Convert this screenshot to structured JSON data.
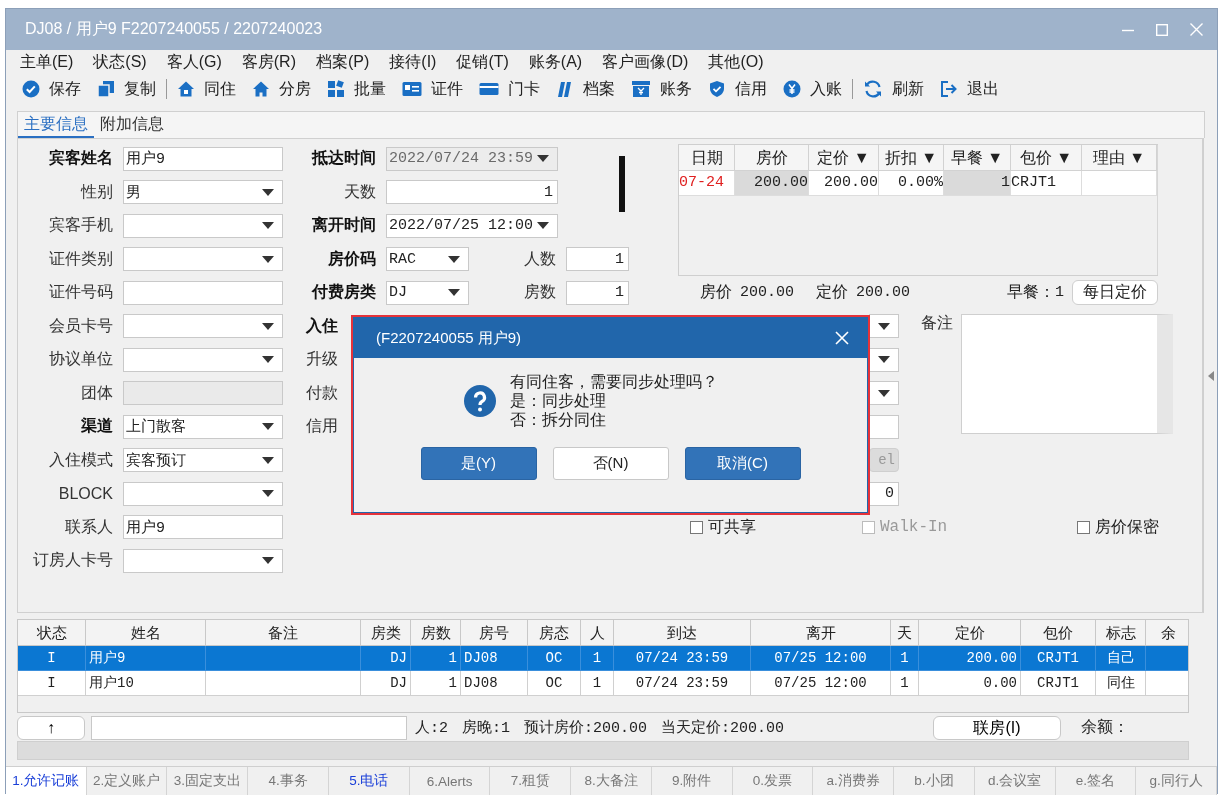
{
  "window": {
    "title": "DJ08 / 用户9 F2207240055 / 2207240023"
  },
  "menu": [
    "主单(E)",
    "状态(S)",
    "客人(G)",
    "客房(R)",
    "档案(P)",
    "接待(I)",
    "促销(T)",
    "账务(A)",
    "客户画像(D)",
    "其他(O)"
  ],
  "toolbar_groups": [
    [
      "保存",
      "复制"
    ],
    [
      "同住",
      "分房",
      "批量",
      "证件",
      "门卡",
      "档案",
      "账务",
      "信用",
      "入账"
    ],
    [
      "刷新",
      "退出"
    ]
  ],
  "tabs": [
    {
      "label": "主要信息",
      "selected": true
    },
    {
      "label": "附加信息",
      "selected": false
    }
  ],
  "guest_form": [
    {
      "label": "宾客姓名",
      "bold": true,
      "kind": "text",
      "value": "用户9"
    },
    {
      "label": "性别",
      "bold": false,
      "kind": "combo",
      "value": "男"
    },
    {
      "label": "宾客手机",
      "bold": false,
      "kind": "combo"
    },
    {
      "label": "证件类别",
      "bold": false,
      "kind": "combo"
    },
    {
      "label": "证件号码",
      "bold": false,
      "kind": "text"
    },
    {
      "label": "会员卡号",
      "bold": false,
      "kind": "combo"
    },
    {
      "label": "协议单位",
      "bold": false,
      "kind": "combo"
    },
    {
      "label": "团体",
      "bold": false,
      "kind": "readonly"
    },
    {
      "label": "渠道",
      "bold": true,
      "kind": "combo",
      "value": "上门散客"
    },
    {
      "label": "入住模式",
      "bold": false,
      "kind": "combo",
      "value": "宾客预订"
    },
    {
      "label": "BLOCK",
      "bold": false,
      "kind": "combo"
    },
    {
      "label": "联系人",
      "bold": false,
      "kind": "text",
      "value": "用户9"
    },
    {
      "label": "订房人卡号",
      "bold": false,
      "kind": "combo"
    }
  ],
  "stay_form": [
    {
      "label": "抵达时间",
      "bold": true,
      "kind": "combo",
      "value": "2022/07/24 23:59",
      "disabled": true
    },
    {
      "label": "天数",
      "bold": false,
      "kind": "number",
      "value": "1"
    },
    {
      "label": "离开时间",
      "bold": true,
      "kind": "combo",
      "value": "2022/07/25 12:00",
      "disabled": false
    },
    {
      "label": "房价码",
      "bold": true,
      "kind": "short_combo",
      "value": "RAC",
      "extra": {
        "label": "人数",
        "value": "1"
      }
    },
    {
      "label": "付费房类",
      "bold": true,
      "kind": "short_combo",
      "value": "DJ",
      "extra": {
        "label": "房数",
        "value": "1"
      }
    },
    {
      "label": "入住",
      "bold": true,
      "kind": "combo_stub"
    },
    {
      "label": "升级",
      "bold": false,
      "kind": "combo_stub"
    },
    {
      "label": "付款",
      "bold": false,
      "kind": "combo_stub"
    },
    {
      "label": "信用",
      "bold": false,
      "kind": "input_stub"
    },
    {
      "kind": "button_stub",
      "value": "el",
      "disabled": true
    },
    {
      "kind": "input_stub",
      "value": "0"
    }
  ],
  "rate_grid": {
    "columns": [
      "日期",
      "房价",
      "定价 ▼",
      "折扣 ▼",
      "早餐 ▼",
      "包价 ▼",
      "理由 ▼"
    ],
    "rows": [
      {
        "date": "07-24",
        "rate": "200.00",
        "fixed": "200.00",
        "discount": "0.00%",
        "breakfast": "1",
        "package": "CRJT1"
      }
    ]
  },
  "rate_summary": {
    "rate_label": "房价",
    "rate": "200.00",
    "fixed_label": "定价",
    "fixed": "200.00",
    "breakfast_label": "早餐：",
    "breakfast": "1",
    "button": "每日定价"
  },
  "remarks": {
    "label": "备注"
  },
  "checkboxes": [
    {
      "label": "可共享",
      "checked": false,
      "disabled": false
    },
    {
      "label": "Walk-In",
      "checked": false,
      "disabled": true
    },
    {
      "label": "房价保密",
      "checked": false,
      "disabled": false
    }
  ],
  "guest_table": {
    "columns": [
      "状态",
      "姓名",
      "备注",
      "房类",
      "房数",
      "房号",
      "房态",
      "人",
      "到达",
      "离开",
      "天",
      "定价",
      "包价",
      "标志",
      "余"
    ],
    "rows": [
      {
        "selected": true,
        "status": "I",
        "name": "用户9",
        "room_type": "DJ",
        "rooms": "1",
        "room_no": "DJ08",
        "room_state": "OC",
        "persons": "1",
        "arrival": "07/24 23:59",
        "departure": "07/25 12:00",
        "days": "1",
        "rate": "200.00",
        "package": "CRJT1",
        "flag": "自己"
      },
      {
        "selected": false,
        "status": "I",
        "name": "用户10",
        "room_type": "DJ",
        "rooms": "1",
        "room_no": "DJ08",
        "room_state": "OC",
        "persons": "1",
        "arrival": "07/24 23:59",
        "departure": "07/25 12:00",
        "days": "1",
        "rate": "0.00",
        "package": "CRJT1",
        "flag": "同住"
      }
    ]
  },
  "footer": {
    "up_button": "↑",
    "persons": "人:2",
    "nights": "房晚:1",
    "expected_rate": "预计房价:200.00",
    "today_rate": "当天定价:200.00",
    "link_button": "联房(I)",
    "balance_label": "余额："
  },
  "bottom_tabs": [
    {
      "label": "1.允许记账",
      "selected": true,
      "highlighted": true
    },
    {
      "label": "2.定义账户",
      "selected": false,
      "highlighted": false
    },
    {
      "label": "3.固定支出",
      "selected": false,
      "highlighted": false
    },
    {
      "label": "4.事务",
      "selected": false,
      "highlighted": false
    },
    {
      "label": "5.电话",
      "selected": false,
      "highlighted": true
    },
    {
      "label": "6.Alerts",
      "selected": false,
      "highlighted": false
    },
    {
      "label": "7.租赁",
      "selected": false,
      "highlighted": false
    },
    {
      "label": "8.大备注",
      "selected": false,
      "highlighted": false
    },
    {
      "label": "9.附件",
      "selected": false,
      "highlighted": false
    },
    {
      "label": "0.发票",
      "selected": false,
      "highlighted": false
    },
    {
      "label": "a.消费券",
      "selected": false,
      "highlighted": false
    },
    {
      "label": "b.小团",
      "selected": false,
      "highlighted": false
    },
    {
      "label": "d.会议室",
      "selected": false,
      "highlighted": false
    },
    {
      "label": "e.签名",
      "selected": false,
      "highlighted": false
    },
    {
      "label": "g.同行人",
      "selected": false,
      "highlighted": false
    }
  ],
  "dialog": {
    "title": "(F2207240055 用户9)",
    "message_lines": [
      "有同住客，需要同步处理吗？",
      "是：同步处理",
      "否：拆分同住"
    ],
    "buttons": [
      {
        "label": "是(Y)",
        "primary": true
      },
      {
        "label": "否(N)",
        "primary": false
      },
      {
        "label": "取消(C)",
        "primary": true
      }
    ]
  }
}
